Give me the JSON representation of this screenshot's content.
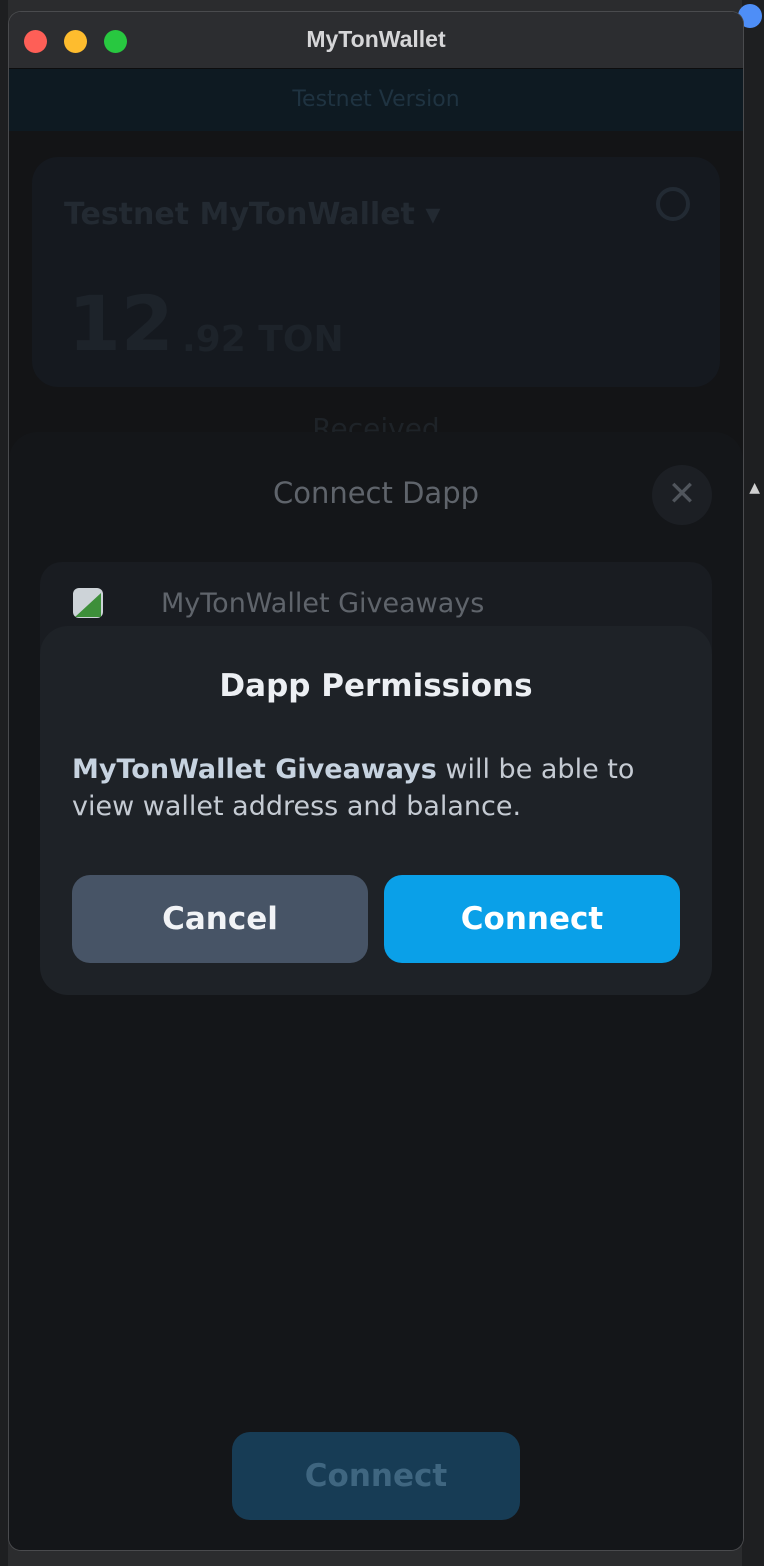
{
  "window": {
    "title": "MyTonWallet"
  },
  "background_app": {
    "network_banner": "Testnet Version"
  },
  "wallet": {
    "name": "Testnet MyTonWallet",
    "balance_integer": "12",
    "balance_fraction": ".92 TON",
    "section_label": "Received"
  },
  "connect_sheet": {
    "title": "Connect Dapp",
    "close_icon": "close-icon",
    "dapp_name": "MyTonWallet Giveaways",
    "connect_label": "Connect"
  },
  "permissions_dialog": {
    "title": "Dapp Permissions",
    "dapp_name": "MyTonWallet Giveaways",
    "description_suffix": " will be able to view wallet address and balance.",
    "cancel_label": "Cancel",
    "connect_label": "Connect"
  },
  "colors": {
    "accent": "#0aa0e8",
    "cancel_button": "#475466",
    "dialog_background": "#1e2227"
  }
}
